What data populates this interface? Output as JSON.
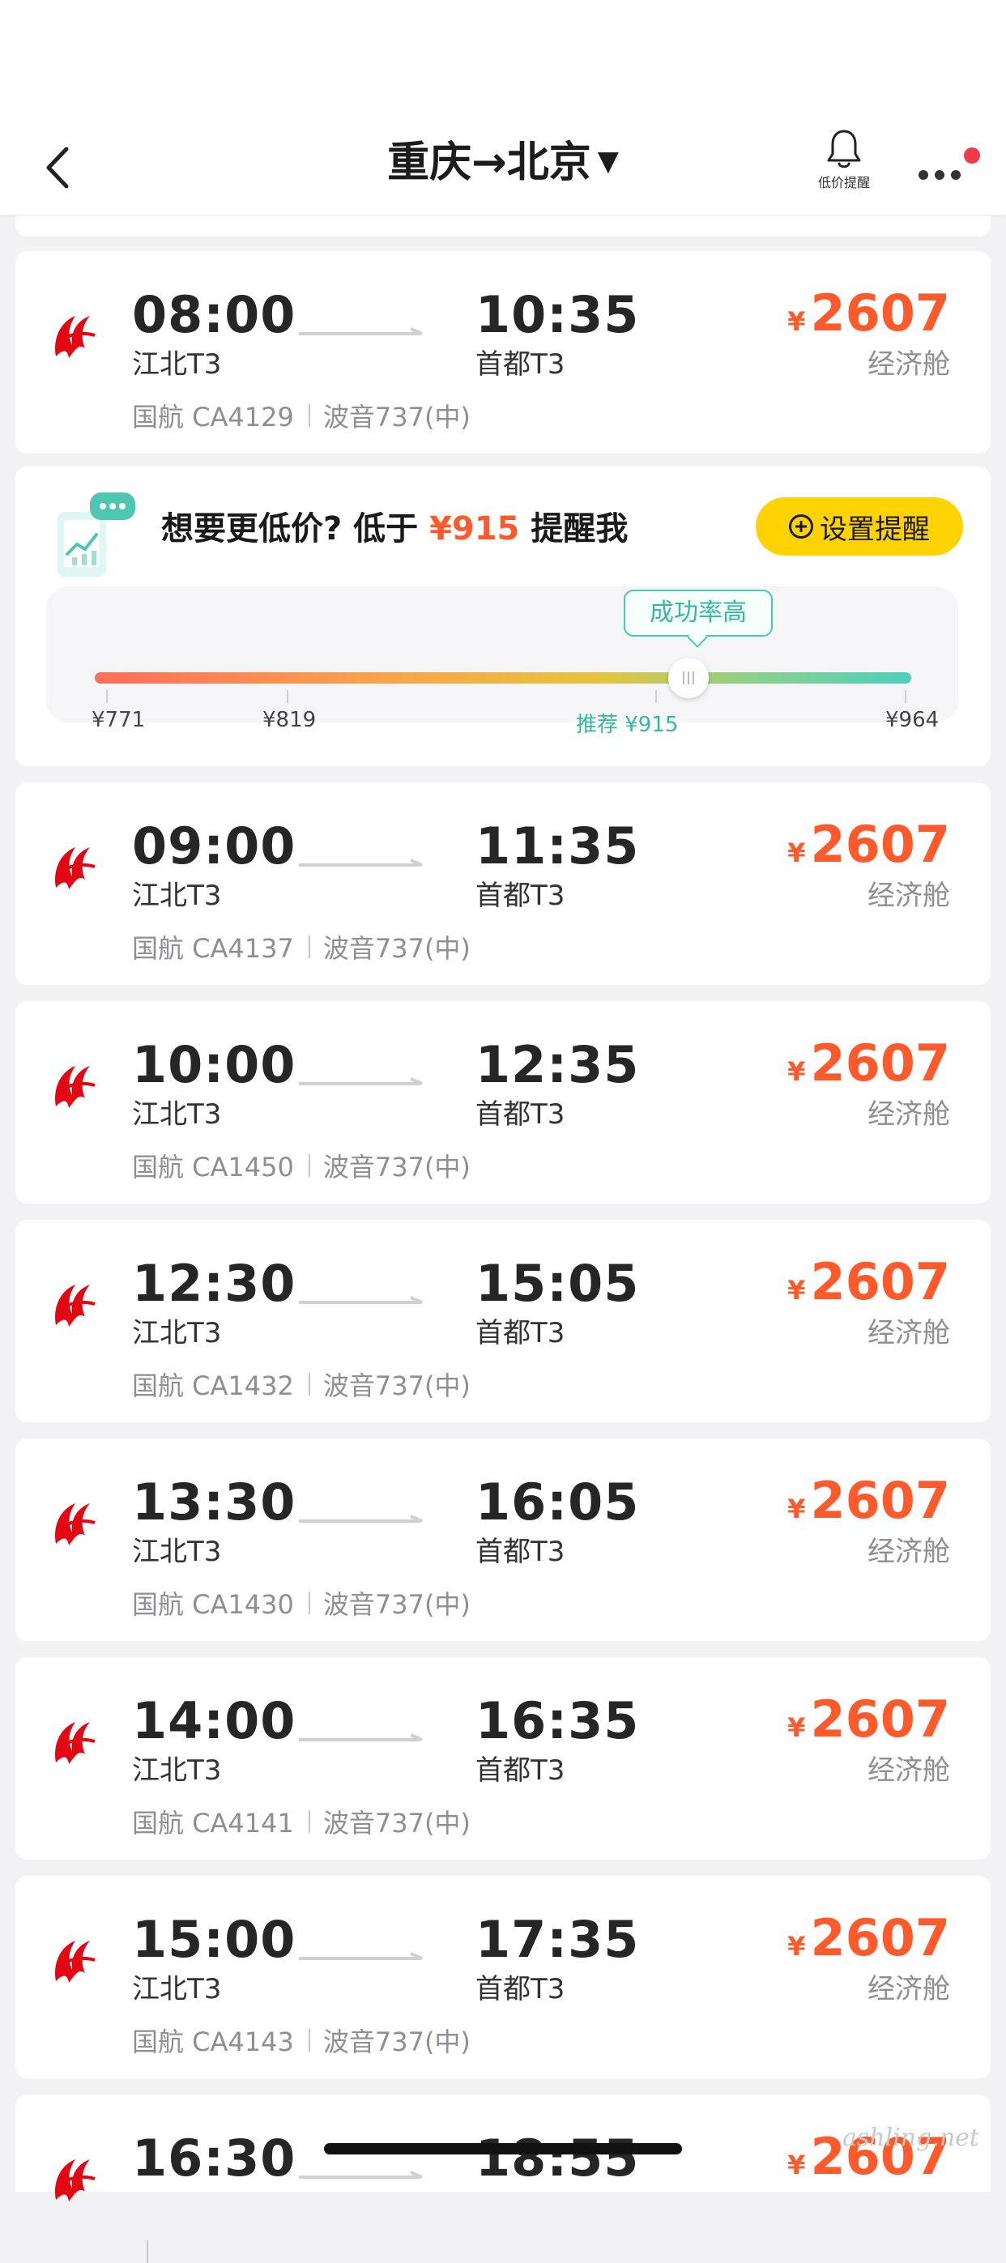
{
  "header": {
    "title": "重庆→北京",
    "dropdown_icon": "caret-down",
    "back_icon": "chevron-left",
    "bell_label": "低价提醒",
    "more_icon": "ellipsis-horizontal",
    "has_notification_dot": true
  },
  "alert": {
    "prefix": "想要更低价?  低于 ",
    "price": "¥915",
    "suffix": " 提醒我",
    "button_label": "设置提醒",
    "bubble_label": "成功率高",
    "ticks": [
      {
        "label": "¥771"
      },
      {
        "label": "¥819"
      },
      {
        "label": "推荐 ¥915"
      },
      {
        "label": "¥964"
      }
    ],
    "recommended_position": 0.73,
    "colors": {
      "button": "#ffd200",
      "price": "#ff5a2c",
      "accent": "#4dc7b0"
    }
  },
  "flights": [
    {
      "dep_time": "08:00",
      "dep_airport": "江北T3",
      "arr_time": "10:35",
      "arr_airport": "首都T3",
      "airline_flight": "国航 CA4129",
      "aircraft": "波音737(中)",
      "currency": "¥",
      "price": "2607",
      "cabin": "经济舱"
    },
    {
      "dep_time": "09:00",
      "dep_airport": "江北T3",
      "arr_time": "11:35",
      "arr_airport": "首都T3",
      "airline_flight": "国航 CA4137",
      "aircraft": "波音737(中)",
      "currency": "¥",
      "price": "2607",
      "cabin": "经济舱"
    },
    {
      "dep_time": "10:00",
      "dep_airport": "江北T3",
      "arr_time": "12:35",
      "arr_airport": "首都T3",
      "airline_flight": "国航 CA1450",
      "aircraft": "波音737(中)",
      "currency": "¥",
      "price": "2607",
      "cabin": "经济舱"
    },
    {
      "dep_time": "12:30",
      "dep_airport": "江北T3",
      "arr_time": "15:05",
      "arr_airport": "首都T3",
      "airline_flight": "国航 CA1432",
      "aircraft": "波音737(中)",
      "currency": "¥",
      "price": "2607",
      "cabin": "经济舱"
    },
    {
      "dep_time": "13:30",
      "dep_airport": "江北T3",
      "arr_time": "16:05",
      "arr_airport": "首都T3",
      "airline_flight": "国航 CA1430",
      "aircraft": "波音737(中)",
      "currency": "¥",
      "price": "2607",
      "cabin": "经济舱"
    },
    {
      "dep_time": "14:00",
      "dep_airport": "江北T3",
      "arr_time": "16:35",
      "arr_airport": "首都T3",
      "airline_flight": "国航 CA4141",
      "aircraft": "波音737(中)",
      "currency": "¥",
      "price": "2607",
      "cabin": "经济舱"
    },
    {
      "dep_time": "15:00",
      "dep_airport": "江北T3",
      "arr_time": "17:35",
      "arr_airport": "首都T3",
      "airline_flight": "国航 CA4143",
      "aircraft": "波音737(中)",
      "currency": "¥",
      "price": "2607",
      "cabin": "经济舱"
    },
    {
      "dep_time": "16:30",
      "dep_airport": "",
      "arr_time": "18:55",
      "arr_airport": "",
      "airline_flight": "",
      "aircraft": "",
      "currency": "¥",
      "price": "2607",
      "cabin": ""
    }
  ],
  "watermark": "ashling.net"
}
